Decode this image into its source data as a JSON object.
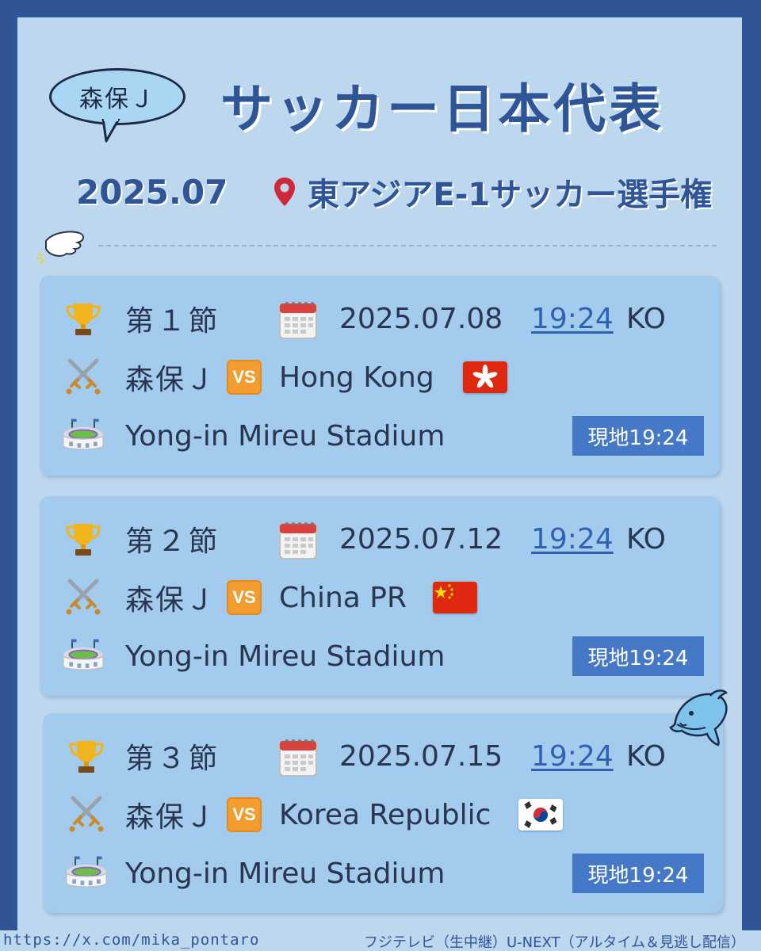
{
  "header": {
    "bubble_label": "森保Ｊ",
    "title": "サッカー日本代表",
    "date": "2025.07",
    "event": "東アジアE-1サッカー選手権"
  },
  "icons": {
    "round": "trophy-icon",
    "date": "calendar-icon",
    "match": "crossed-swords-icon",
    "venue": "stadium-icon",
    "location": "map-pin-icon",
    "vs": "vs-icon"
  },
  "colors": {
    "background": "#2f5597",
    "panel": "#bcd7ee",
    "card": "#a2cbee",
    "title": "#2f5597",
    "badge": "#4678c8",
    "pin": "#d0283b"
  },
  "matches": [
    {
      "round": "第１節",
      "date": "2025.07.08",
      "time": "19:24",
      "ko": "KO",
      "team": "森保Ｊ",
      "vs": "VS",
      "opponent": "Hong Kong",
      "flag": "hong-kong-flag",
      "venue": "Yong-in Mireu Stadium",
      "local_time": "現地19:24"
    },
    {
      "round": "第２節",
      "date": "2025.07.12",
      "time": "19:24",
      "ko": "KO",
      "team": "森保Ｊ",
      "vs": "VS",
      "opponent": "China PR",
      "flag": "china-flag",
      "venue": "Yong-in Mireu Stadium",
      "local_time": "現地19:24"
    },
    {
      "round": "第３節",
      "date": "2025.07.15",
      "time": "19:24",
      "ko": "KO",
      "team": "森保Ｊ",
      "vs": "VS",
      "opponent": "Korea Republic",
      "flag": "south-korea-flag",
      "venue": "Yong-in Mireu Stadium",
      "local_time": "現地19:24"
    }
  ],
  "footer": {
    "url": "https://x.com/mika_pontaro",
    "broadcast": "フジテレビ（生中継）U-NEXT（アルタイム＆見逃し配信）"
  }
}
